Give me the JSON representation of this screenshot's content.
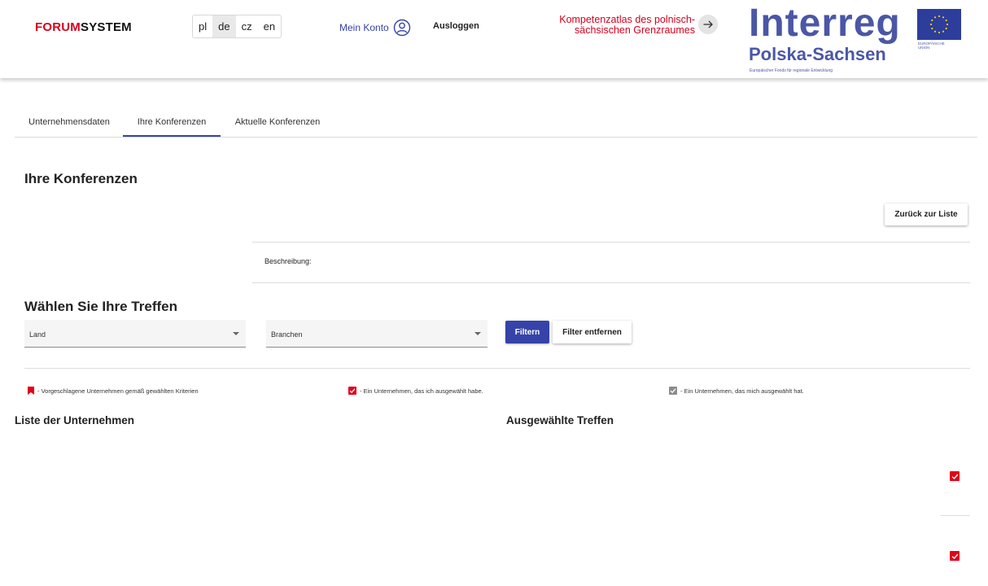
{
  "header": {
    "brand_part1": "FORUM",
    "brand_part2": "SYSTEM",
    "languages": [
      {
        "code": "pl",
        "active": false
      },
      {
        "code": "de",
        "active": true
      },
      {
        "code": "cz",
        "active": false
      },
      {
        "code": "en",
        "active": false
      }
    ],
    "my_account": "Mein Konto",
    "logout": "Ausloggen",
    "atlas_line1": "Kompetenzatlas des polnisch-",
    "atlas_line2": "sächsischen Grenzraumes",
    "logo_interreg": "Interreg",
    "logo_region": "Polska-Sachsen",
    "logo_fund": "Europäischer Fonds für regionale Entwicklung",
    "eu_line1": "EUROPÄISCHE",
    "eu_line2": "UNION"
  },
  "tabs": [
    {
      "label": "Unternehmensdaten",
      "active": false
    },
    {
      "label": "Ihre Konferenzen",
      "active": true
    },
    {
      "label": "Aktuelle Konferenzen",
      "active": false
    }
  ],
  "main": {
    "title": "Ihre Konferenzen",
    "back_button": "Zurück zur Liste",
    "description_label": "Beschreibung:",
    "meetings_title": "Wählen Sie Ihre Treffen",
    "filter_country": "Land",
    "filter_industry": "Branchen",
    "filter_button": "Filtern",
    "clear_filter_button": "Filter entfernen",
    "legend_suggested": "- Vorgeschlagene Unternehmen gemäß gewählten Kriterien",
    "legend_selected_by_me": "- Ein Unternehmen, das ich ausgewählt habe.",
    "legend_selected_me": "- Ein Unternehmen, das mich ausgewählt hat.",
    "company_list_title": "Liste der Unternehmen",
    "selected_meetings_title": "Ausgewählte Treffen"
  },
  "colors": {
    "accent": "#3643a8",
    "brand_red": "#d6001c",
    "checkbox_red": "#e2001a",
    "checkbox_grey": "#8c8c8c"
  },
  "icons": {
    "account": "user-circle-icon",
    "atlas_arrow": "arrow-right-icon",
    "dropdown": "caret-down-icon",
    "suggested": "bookmark-icon",
    "selected_by_me": "checkbox-checked-red-icon",
    "selected_me": "checkbox-checked-grey-icon"
  }
}
